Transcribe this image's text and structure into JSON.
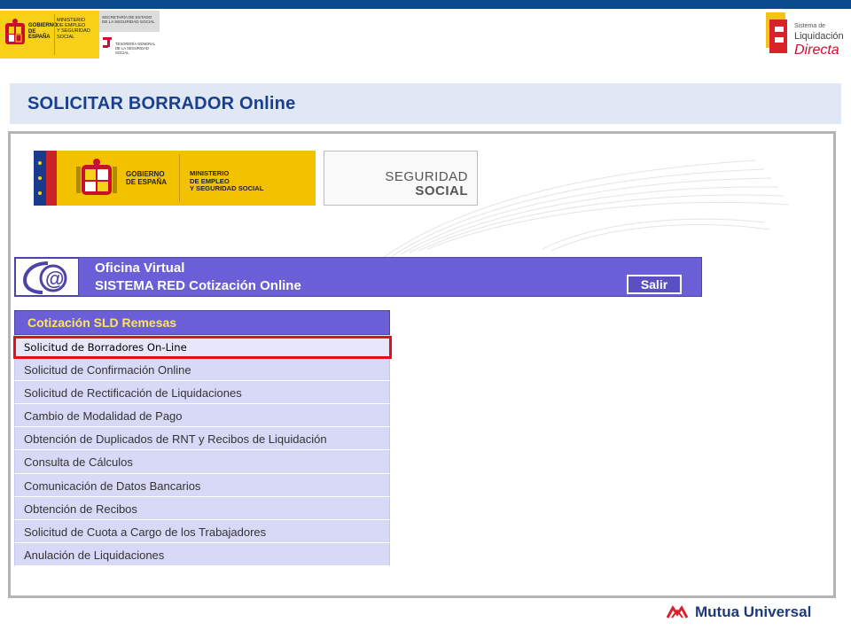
{
  "header": {
    "gov_left_line1": "GOBIERNO",
    "gov_left_line2": "DE ESPAÑA",
    "gov_right_line1": "MINISTERIO",
    "gov_right_line2": "DE EMPLEO",
    "gov_right_line3": "Y SEGURIDAD SOCIAL",
    "sec_line1": "SECRETARÍA DE ESTADO",
    "sec_line2": "DE LA SEGURIDAD SOCIAL",
    "tgss_line1": "TESORERÍA GENERAL",
    "tgss_line2": "DE LA SEGURIDAD SOCIAL",
    "sld_line1": "Sistema de",
    "sld_line2": "Liquidación",
    "sld_line3": "Directa"
  },
  "page_title": "SOLICITAR BORRADOR Online",
  "screenshot": {
    "gov_line1": "GOBIERNO",
    "gov_line2": "DE ESPAÑA",
    "min_line1": "MINISTERIO",
    "min_line2": "DE EMPLEO",
    "min_line3": "Y SEGURIDAD SOCIAL",
    "ss_line1": "SEGURIDAD",
    "ss_line2": "SOCIAL",
    "office_line1": "Oficina Virtual",
    "office_line2": "SISTEMA RED Cotización Online",
    "exit_button": "Salir",
    "menu_title": "Cotización SLD Remesas",
    "menu_items": [
      "Solicitud de Borradores On-Line",
      "Solicitud de Confirmación Online",
      "Solicitud de Rectificación de Liquidaciones",
      "Cambio de Modalidad de Pago",
      "Obtención de Duplicados de RNT y Recibos de Liquidación",
      "Consulta de Cálculos",
      "Comunicación de Datos Bancarios",
      "Obtención de Recibos",
      "Solicitud de Cuota a Cargo de los Trabajadores",
      "Anulación de Liquidaciones"
    ]
  },
  "footer": {
    "brand": "Mutua Universal"
  },
  "colors": {
    "title": "#1b3f8f",
    "menu_bar": "#6a5fd6",
    "menu_item": "#d7d9f7",
    "highlight": "#e0111b"
  }
}
